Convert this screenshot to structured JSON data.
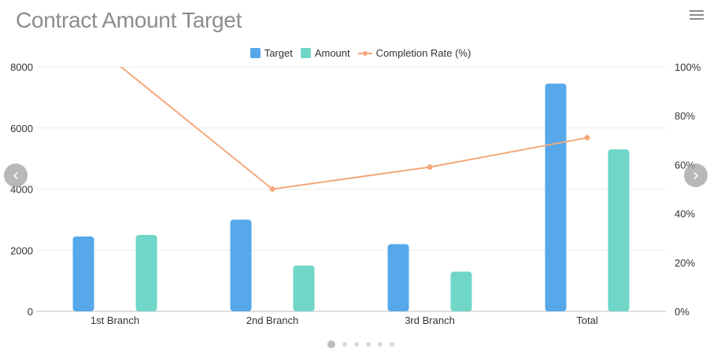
{
  "title": "Contract Amount Target",
  "menu_icon": "hamburger-menu-icon",
  "legend": [
    {
      "label": "Target",
      "color": "#56a8ea",
      "kind": "bar"
    },
    {
      "label": "Amount",
      "color": "#6fd6c8",
      "kind": "bar"
    },
    {
      "label": "Completion Rate (%)",
      "color": "#f2a87a",
      "kind": "line"
    }
  ],
  "nav": {
    "prev_icon": "chevron-left-icon",
    "next_icon": "chevron-right-icon"
  },
  "pagination": {
    "count": 6,
    "active": 0
  },
  "chart_data": {
    "type": "bar",
    "categories": [
      "1st Branch",
      "2nd Branch",
      "3rd Branch",
      "Total"
    ],
    "series": [
      {
        "name": "Target",
        "type": "bar",
        "axis": "left",
        "color": "#56a8ea",
        "values": [
          2450,
          3000,
          2200,
          7450
        ]
      },
      {
        "name": "Amount",
        "type": "bar",
        "axis": "left",
        "color": "#6fd6c8",
        "values": [
          2500,
          1500,
          1300,
          5300
        ]
      },
      {
        "name": "Completion Rate (%)",
        "type": "line",
        "axis": "right",
        "color": "#f2a87a",
        "values": [
          102,
          50,
          59,
          71
        ]
      }
    ],
    "y_left": {
      "ylim": [
        0,
        8000
      ],
      "ticks": [
        "0",
        "2000",
        "4000",
        "6000",
        "8000"
      ]
    },
    "y_right": {
      "ylim": [
        0,
        100
      ],
      "ticks": [
        "0%",
        "20%",
        "40%",
        "60%",
        "80%",
        "100%"
      ]
    },
    "grid": true,
    "legend_position": "top-center"
  }
}
